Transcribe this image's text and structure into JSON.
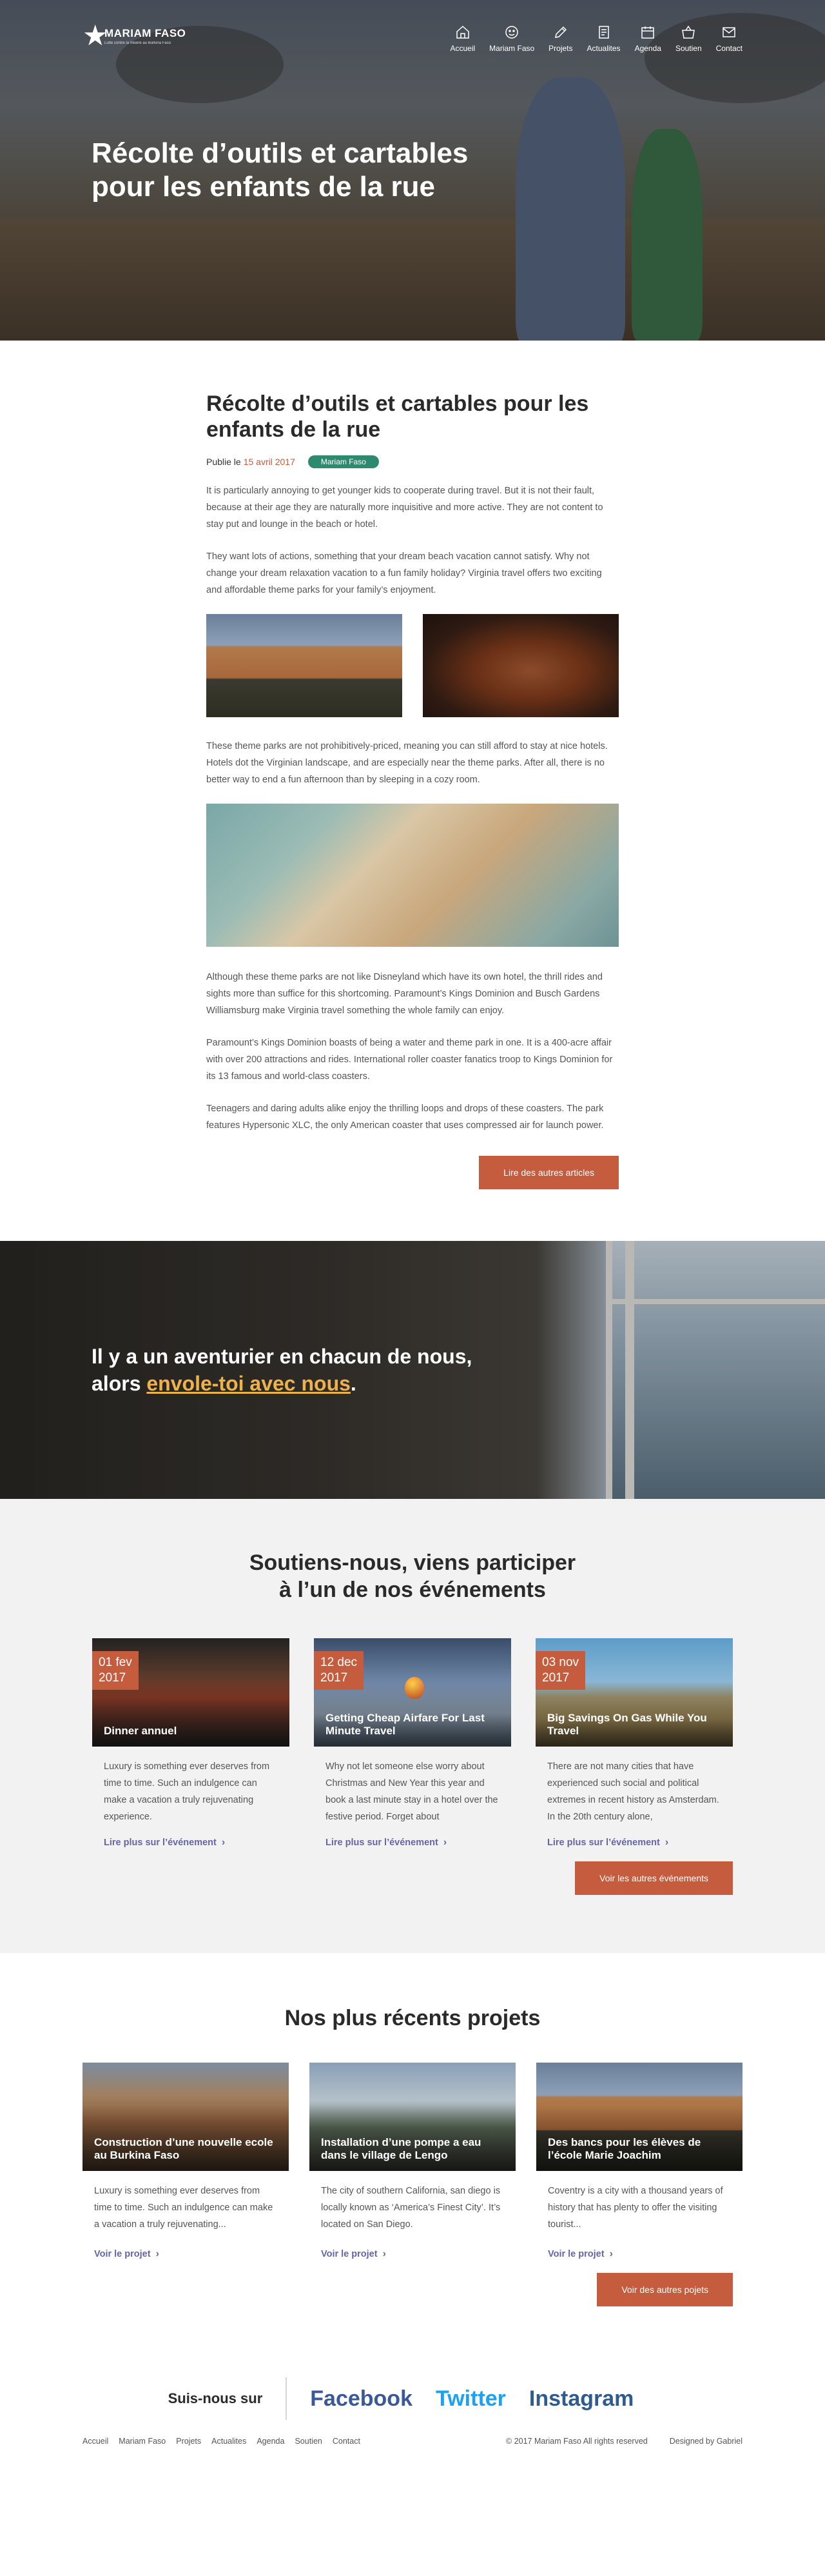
{
  "brand": {
    "name": "MARIAM FASO",
    "tagline": "Lutte contre la misère au Burkina Faso"
  },
  "nav": [
    {
      "label": "Accueil",
      "icon": "home-icon"
    },
    {
      "label": "Mariam Faso",
      "icon": "smiley-icon"
    },
    {
      "label": "Projets",
      "icon": "pencil-icon"
    },
    {
      "label": "Actualites",
      "icon": "document-icon"
    },
    {
      "label": "Agenda",
      "icon": "calendar-icon"
    },
    {
      "label": "Soutien",
      "icon": "basket-icon"
    },
    {
      "label": "Contact",
      "icon": "mail-icon"
    }
  ],
  "hero": {
    "title": "Récolte d’outils et cartables pour les enfants de la rue"
  },
  "article": {
    "title": "Récolte d’outils et cartables pour les enfants de la rue",
    "published_prefix": "Publie le",
    "date": "15 avril 2017",
    "author_badge": "Mariam Faso",
    "p1": "It is particularly annoying to get younger kids to cooperate during travel. But it is not their fault, because at their age they are naturally more inquisitive and more active. They are not content to stay put and lounge in the beach or hotel.",
    "p2": "They want lots of actions, something that your dream beach vacation cannot satisfy. Why not change your dream relaxation vacation to a fun family holiday? Virginia travel offers two exciting and affordable theme parks for your family’s enjoyment.",
    "p3": "These theme parks are not prohibitively-priced, meaning you can still afford to stay at nice hotels. Hotels dot the Virginian landscape, and are especially near the theme parks. After all, there is no better way to end a fun afternoon than by sleeping in a cozy room.",
    "p4": "Although these theme parks are not like Disneyland which have its own hotel, the thrill rides and sights more than suffice for this shortcoming. Paramount’s Kings Dominion and Busch Gardens Williamsburg make Virginia travel something the whole family can enjoy.",
    "p5": "Paramount’s Kings Dominion boasts of being a water and theme park in one. It is a 400-acre affair with over 200 attractions and rides. International roller coaster fanatics troop to Kings Dominion for its 13 famous and world-class coasters.",
    "p6": "Teenagers and daring adults alike enjoy the thrilling loops and drops of these coasters. The park features Hypersonic XLC, the only American coaster that uses compressed air for launch power.",
    "more_button": "Lire des autres articles"
  },
  "quote": {
    "line1": "Il y a un aventurier en chacun de nous,",
    "line2_prefix": "alors",
    "line2_highlight": "envole-toi avec nous",
    "line2_suffix": "."
  },
  "events": {
    "title_line1": "Soutiens-nous, viens participer",
    "title_line2": "à l’un de nos événements",
    "cards": [
      {
        "date_day": "01 fev",
        "date_year": "2017",
        "title": "Dinner annuel",
        "text": "Luxury is something ever  deserves from time to time. Such an indulgence can make a vacation a truly rejuvenating experience.",
        "link": "Lire plus sur l’événement"
      },
      {
        "date_day": "12 dec",
        "date_year": "2017",
        "title": "Getting Cheap Airfare For Last Minute Travel",
        "text": "Why not let someone else worry about Christmas and New Year this year and book a last minute stay in a hotel over the festive period. Forget about",
        "link": "Lire plus sur l’événement"
      },
      {
        "date_day": "03 nov",
        "date_year": "2017",
        "title": "Big Savings On Gas While You Travel",
        "text": "There are not many cities that have experienced such social and political extremes in recent history as Amsterdam. In the 20th century alone,",
        "link": "Lire plus sur l’événement"
      }
    ],
    "more_button": "Voir les autres événements"
  },
  "projects": {
    "title": "Nos plus récents projets",
    "cards": [
      {
        "title": "Construction d’une nouvelle ecole au Burkina Faso",
        "text": "Luxury is something ever  deserves from time to time. Such an indulgence can make a vacation a truly rejuvenating...",
        "link": "Voir le projet"
      },
      {
        "title": "Installation d’une pompe a eau dans  le village de Lengo",
        "text": "The city of southern California, san diego is locally known as ‘America’s Finest City’. It’s located on San Diego.",
        "link": "Voir le projet"
      },
      {
        "title": "Des bancs pour les élèves de l’école Marie Joachim",
        "text": "Coventry is a city with a thousand years of history that has plenty to offer the visiting tourist...",
        "link": "Voir le projet"
      }
    ],
    "more_button": "Voir des autres pojets"
  },
  "footer": {
    "follow_label": "Suis-nous sur",
    "social": [
      "Facebook",
      "Twitter",
      "Instagram"
    ],
    "links": [
      "Accueil",
      "Mariam Faso",
      "Projets",
      "Actualites",
      "Agenda",
      "Soutien",
      "Contact"
    ],
    "copyright": "© 2017 Mariam Faso All rights reserved",
    "credit": "Designed by Gabriel"
  }
}
